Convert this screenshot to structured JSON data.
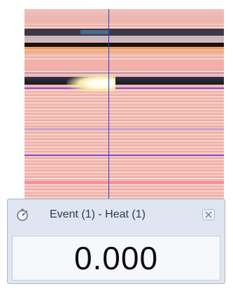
{
  "timer": {
    "title": "Event (1) - Heat (1)",
    "value": "0.000",
    "icon": "stopwatch-icon",
    "close_icon": "close-icon"
  },
  "colors": {
    "finish_line": "#2b3ec8",
    "panel_background": "#dfe6f1",
    "display_background": "#f6f8fb"
  }
}
